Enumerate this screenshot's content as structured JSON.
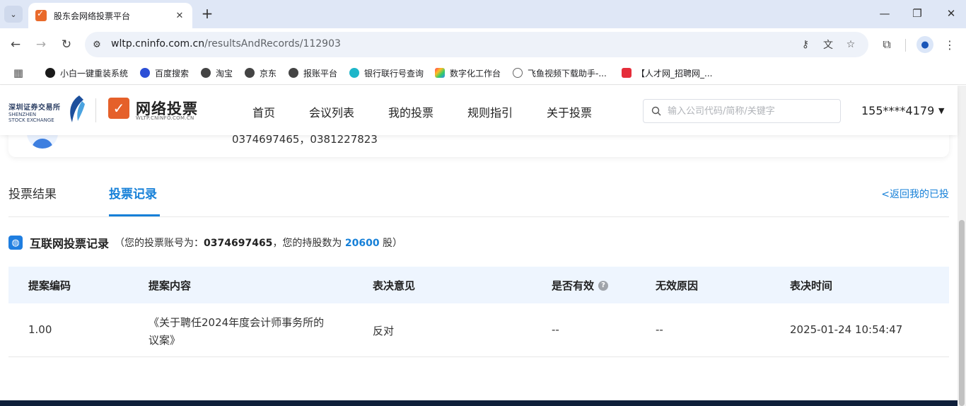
{
  "browser": {
    "tab_title": "股东会网络投票平台",
    "url_host": "wltp.cninfo.com.cn",
    "url_path": "/resultsAndRecords/112903",
    "bookmarks": [
      "小白一键重装系统",
      "百度搜索",
      "淘宝",
      "京东",
      "报账平台",
      "银行联行号查询",
      "数字化工作台",
      "飞鱼视频下载助手-...",
      "【人才网_招聘网_..."
    ]
  },
  "header": {
    "szse_cn": "深圳证券交易所",
    "szse_en_1": "SHENZHEN",
    "szse_en_2": "STOCK EXCHANGE",
    "platform_title": "网络投票",
    "platform_domain": "WLTP.CNINFO.COM.CN",
    "nav": [
      "首页",
      "会议列表",
      "我的投票",
      "规则指引",
      "关于投票"
    ],
    "search_placeholder": "输入公司代码/简称/关键字",
    "user_phone": "155****4179"
  },
  "info_card": {
    "accounts": "0374697465，0381227823"
  },
  "content_tabs": {
    "results": "投票结果",
    "records": "投票记录",
    "back_link": "<返回我的已投"
  },
  "section": {
    "title": "互联网投票记录",
    "account_prefix": "（您的投票账号为：",
    "account": "0374697465",
    "shares_prefix": "，您的持股数为 ",
    "shares": "20600",
    "shares_suffix": " 股）"
  },
  "table": {
    "headers": [
      "提案编码",
      "提案内容",
      "表决意见",
      "是否有效",
      "无效原因",
      "表决时间"
    ],
    "rows": [
      {
        "code": "1.00",
        "content": "《关于聘任2024年度会计师事务所的议案》",
        "opinion": "反对",
        "valid": "--",
        "reason": "--",
        "time": "2025-01-24 10:54:47"
      }
    ]
  },
  "colors": {
    "accent": "#1680d8",
    "logo_orange": "#e5602a",
    "table_head_bg": "#eef5fe"
  }
}
